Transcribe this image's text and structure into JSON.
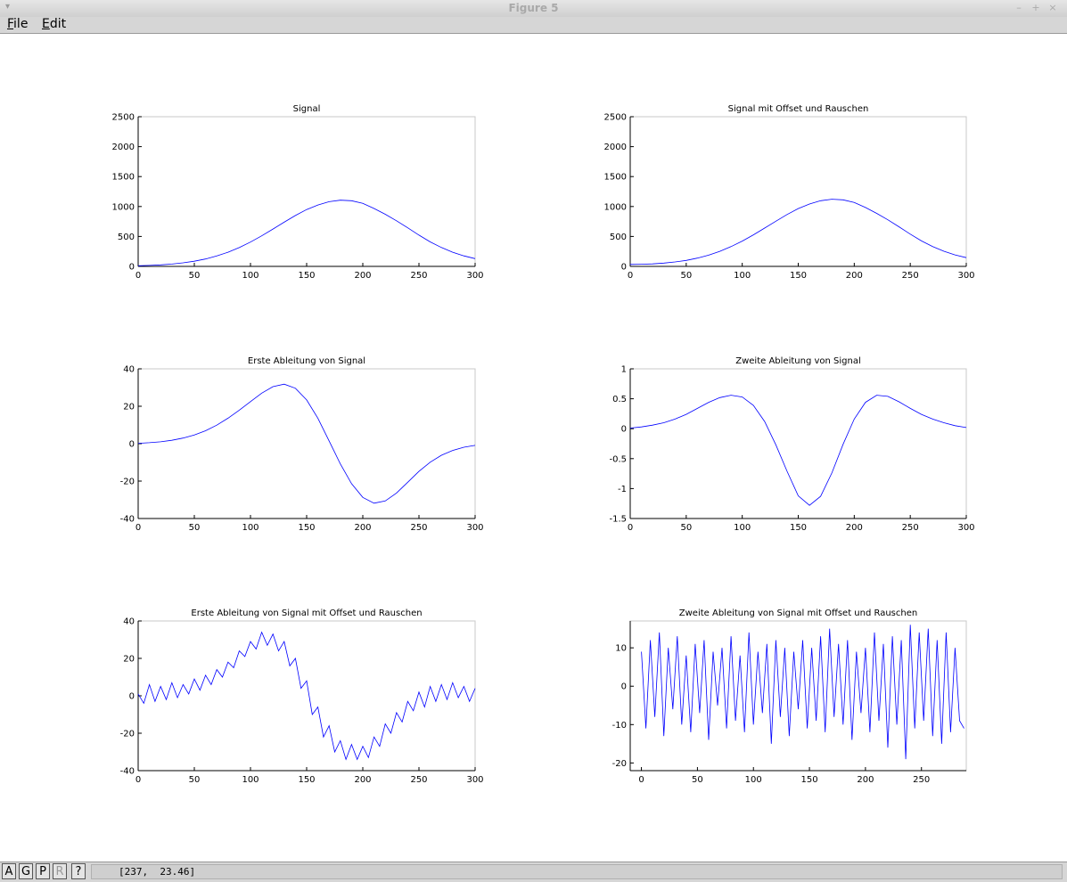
{
  "window": {
    "title": "Figure 5",
    "menu_glyph": "▾",
    "minimize": "–",
    "maximize": "+",
    "close": "×"
  },
  "menubar": {
    "file": {
      "accel": "F",
      "rest": "ile"
    },
    "edit": {
      "accel": "E",
      "rest": "dit"
    }
  },
  "statusbar": {
    "buttons": [
      {
        "label": "A",
        "enabled": true
      },
      {
        "label": "G",
        "enabled": true
      },
      {
        "label": "P",
        "enabled": true
      },
      {
        "label": "R",
        "enabled": false
      },
      {
        "label": "?",
        "enabled": true
      }
    ],
    "coords": "[237,  23.46]"
  },
  "colors": {
    "line": "#0000ff",
    "axis": "#000000",
    "frame": "#c8c8c8",
    "background": "#ffffff"
  },
  "chart_data": [
    {
      "type": "line",
      "title": "Signal",
      "xlabel": "",
      "ylabel": "",
      "xlim": [
        0,
        300
      ],
      "ylim": [
        0,
        2500
      ],
      "xticks": [
        0,
        50,
        100,
        150,
        200,
        250,
        300
      ],
      "yticks": [
        0,
        500,
        1000,
        1500,
        2000,
        2500
      ],
      "series": [
        {
          "x": [
            0,
            10,
            20,
            30,
            40,
            50,
            60,
            70,
            80,
            90,
            100,
            110,
            120,
            130,
            140,
            150,
            160,
            170,
            180,
            190,
            200,
            210,
            220,
            230,
            240,
            250,
            260,
            270,
            280,
            290,
            300
          ],
          "y": [
            10,
            16,
            25,
            39,
            59,
            86,
            124,
            174,
            237,
            314,
            406,
            511,
            624,
            738,
            849,
            950,
            1026,
            1080,
            1106,
            1096,
            1053,
            968,
            870,
            762,
            644,
            522,
            409,
            316,
            237,
            176,
            130
          ]
        }
      ]
    },
    {
      "type": "line",
      "title": "Signal mit Offset und Rauschen",
      "xlabel": "",
      "ylabel": "",
      "xlim": [
        0,
        300
      ],
      "ylim": [
        0,
        2500
      ],
      "xticks": [
        0,
        50,
        100,
        150,
        200,
        250,
        300
      ],
      "yticks": [
        0,
        500,
        1000,
        1500,
        2000,
        2500
      ],
      "series": [
        {
          "x": [
            0,
            10,
            20,
            30,
            40,
            50,
            60,
            70,
            80,
            90,
            100,
            110,
            120,
            130,
            140,
            150,
            160,
            170,
            180,
            190,
            200,
            210,
            220,
            230,
            240,
            250,
            260,
            270,
            280,
            290,
            300
          ],
          "y": [
            32,
            35,
            42,
            55,
            74,
            100,
            138,
            188,
            252,
            330,
            422,
            527,
            640,
            754,
            866,
            966,
            1042,
            1096,
            1122,
            1112,
            1069,
            984,
            886,
            778,
            660,
            538,
            425,
            332,
            253,
            192,
            146
          ]
        }
      ]
    },
    {
      "type": "line",
      "title": "Erste Ableitung von Signal",
      "xlabel": "",
      "ylabel": "",
      "xlim": [
        0,
        300
      ],
      "ylim": [
        -40,
        40
      ],
      "xticks": [
        0,
        50,
        100,
        150,
        200,
        250,
        300
      ],
      "yticks": [
        -40,
        -20,
        0,
        20,
        40
      ],
      "series": [
        {
          "x": [
            0,
            10,
            20,
            30,
            40,
            50,
            60,
            70,
            80,
            90,
            100,
            110,
            120,
            130,
            140,
            150,
            160,
            170,
            180,
            190,
            200,
            210,
            220,
            230,
            240,
            250,
            260,
            270,
            280,
            290,
            300
          ],
          "y": [
            0.2,
            0.5,
            1,
            1.8,
            3,
            4.6,
            6.9,
            9.9,
            13.6,
            17.9,
            22.5,
            27.0,
            30.5,
            31.8,
            29.6,
            23.4,
            13.6,
            1.5,
            -10.8,
            -21.4,
            -28.7,
            -31.8,
            -30.6,
            -26.4,
            -20.6,
            -14.8,
            -9.9,
            -6.2,
            -3.6,
            -1.9,
            -0.9
          ]
        }
      ]
    },
    {
      "type": "line",
      "title": "Zweite Ableitung von Signal",
      "xlabel": "",
      "ylabel": "",
      "xlim": [
        0,
        300
      ],
      "ylim": [
        -1.5,
        1
      ],
      "xticks": [
        0,
        50,
        100,
        150,
        200,
        250,
        300
      ],
      "yticks": [
        -1.5,
        -1,
        -0.5,
        0,
        0.5,
        1
      ],
      "series": [
        {
          "x": [
            0,
            10,
            20,
            30,
            40,
            50,
            60,
            70,
            80,
            90,
            100,
            110,
            120,
            130,
            140,
            150,
            160,
            170,
            180,
            190,
            200,
            210,
            220,
            230,
            240,
            250,
            260,
            270,
            280,
            290,
            300
          ],
          "y": [
            0.01,
            0.03,
            0.06,
            0.1,
            0.16,
            0.24,
            0.34,
            0.44,
            0.52,
            0.56,
            0.53,
            0.39,
            0.12,
            -0.27,
            -0.71,
            -1.12,
            -1.28,
            -1.13,
            -0.74,
            -0.26,
            0.16,
            0.44,
            0.56,
            0.54,
            0.45,
            0.34,
            0.24,
            0.16,
            0.1,
            0.05,
            0.02
          ]
        }
      ]
    },
    {
      "type": "line",
      "title": "Erste Ableitung von Signal mit Offset und Rauschen",
      "xlabel": "",
      "ylabel": "",
      "xlim": [
        0,
        300
      ],
      "ylim": [
        -40,
        40
      ],
      "xticks": [
        0,
        50,
        100,
        150,
        200,
        250,
        300
      ],
      "yticks": [
        -40,
        -20,
        0,
        20,
        40
      ],
      "series": [
        {
          "x": [
            0,
            5,
            10,
            15,
            20,
            25,
            30,
            35,
            40,
            45,
            50,
            55,
            60,
            65,
            70,
            75,
            80,
            85,
            90,
            95,
            100,
            105,
            110,
            115,
            120,
            125,
            130,
            135,
            140,
            145,
            150,
            155,
            160,
            165,
            170,
            175,
            180,
            185,
            190,
            195,
            200,
            205,
            210,
            215,
            220,
            225,
            230,
            235,
            240,
            245,
            250,
            255,
            260,
            265,
            270,
            275,
            280,
            285,
            290,
            295,
            300
          ],
          "y": [
            1,
            -4,
            6,
            -3,
            5,
            -2,
            7,
            -1,
            6,
            1,
            9,
            3,
            11,
            6,
            14,
            10,
            18,
            15,
            24,
            21,
            29,
            25,
            34,
            27,
            33,
            24,
            29,
            16,
            20,
            4,
            8,
            -10,
            -6,
            -22,
            -16,
            -30,
            -24,
            -34,
            -26,
            -34,
            -27,
            -33,
            -22,
            -27,
            -15,
            -20,
            -9,
            -14,
            -3,
            -8,
            2,
            -6,
            5,
            -3,
            6,
            -2,
            7,
            -1,
            5,
            -3,
            4
          ]
        }
      ]
    },
    {
      "type": "line",
      "title": "Zweite Ableitung von Signal mit Offset und Rauschen",
      "xlabel": "",
      "ylabel": "",
      "xlim": [
        -10,
        290
      ],
      "ylim": [
        -22,
        17
      ],
      "xticks": [
        0,
        50,
        100,
        150,
        200,
        250
      ],
      "yticks": [
        -20,
        -10,
        0,
        10
      ],
      "series": [
        {
          "x": [
            0,
            4,
            8,
            12,
            16,
            20,
            24,
            28,
            32,
            36,
            40,
            44,
            48,
            52,
            56,
            60,
            64,
            68,
            72,
            76,
            80,
            84,
            88,
            92,
            96,
            100,
            104,
            108,
            112,
            116,
            120,
            124,
            128,
            132,
            136,
            140,
            144,
            148,
            152,
            156,
            160,
            164,
            168,
            172,
            176,
            180,
            184,
            188,
            192,
            196,
            200,
            204,
            208,
            212,
            216,
            220,
            224,
            228,
            232,
            236,
            240,
            244,
            248,
            252,
            256,
            260,
            264,
            268,
            272,
            276,
            280,
            284,
            288
          ],
          "y": [
            9,
            -11,
            12,
            -8,
            14,
            -13,
            10,
            -6,
            13,
            -10,
            8,
            -12,
            11,
            -7,
            12,
            -14,
            9,
            -5,
            10,
            -11,
            13,
            -9,
            8,
            -12,
            14,
            -10,
            9,
            -7,
            11,
            -15,
            12,
            -8,
            10,
            -13,
            9,
            -6,
            12,
            -11,
            10,
            -9,
            13,
            -12,
            15,
            -8,
            11,
            -10,
            12,
            -14,
            9,
            -7,
            10,
            -12,
            14,
            -9,
            11,
            -16,
            13,
            -10,
            12,
            -19,
            16,
            -11,
            14,
            -9,
            15,
            -13,
            12,
            -15,
            14,
            -12,
            10,
            -9,
            -11
          ]
        }
      ]
    }
  ]
}
